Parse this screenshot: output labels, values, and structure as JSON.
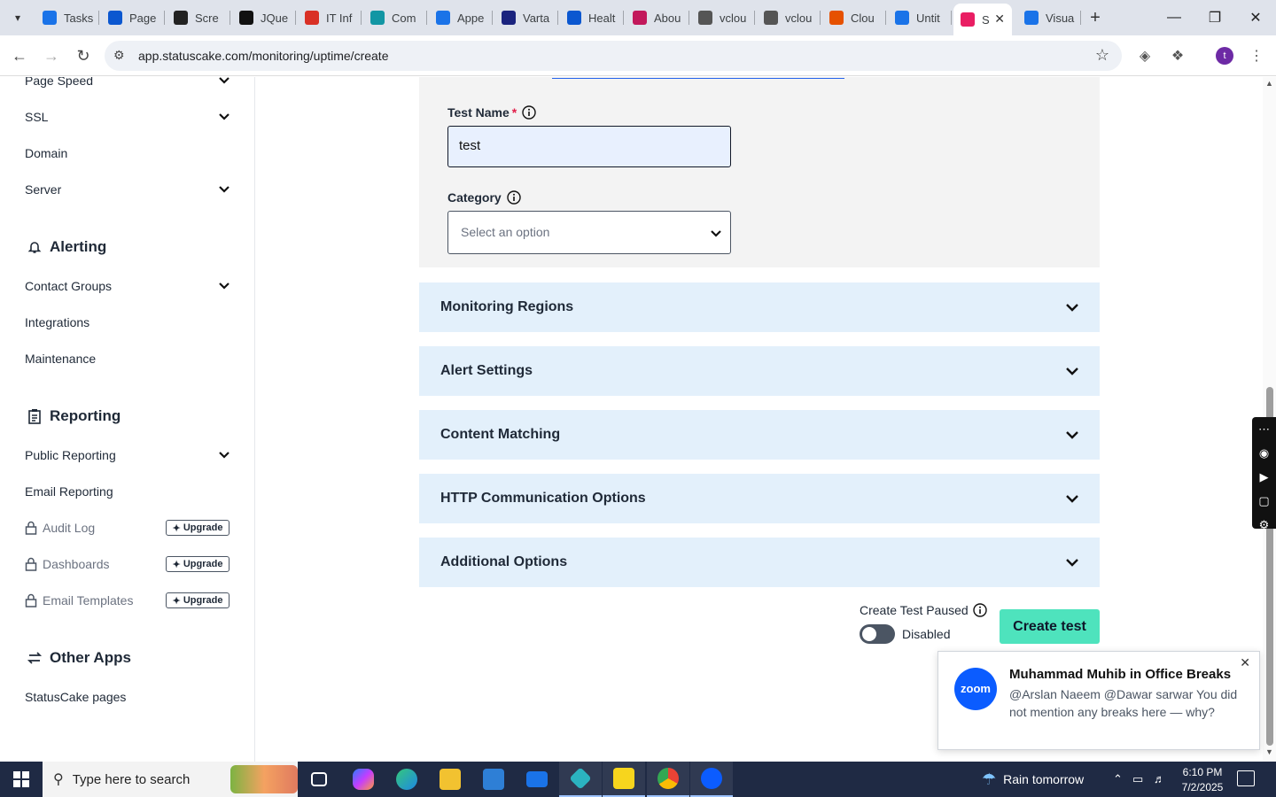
{
  "browser": {
    "tabs": [
      {
        "label": "Tasks",
        "color": "#1a73e8"
      },
      {
        "label": "Page",
        "color": "#0b57d0"
      },
      {
        "label": "Scre",
        "color": "#222222"
      },
      {
        "label": "JQue",
        "color": "#111111"
      },
      {
        "label": "IT Inf",
        "color": "#d93025"
      },
      {
        "label": "Com",
        "color": "#1296a4"
      },
      {
        "label": "Appe",
        "color": "#1a73e8"
      },
      {
        "label": "Varta",
        "color": "#1a237e"
      },
      {
        "label": "Healt",
        "color": "#0b57d0"
      },
      {
        "label": "Abou",
        "color": "#c2185b"
      },
      {
        "label": "vclou",
        "color": "#555555"
      },
      {
        "label": "vclou",
        "color": "#555555"
      },
      {
        "label": "Clou",
        "color": "#e65100"
      },
      {
        "label": "Untit",
        "color": "#1a73e8"
      },
      {
        "label": "S",
        "color": "#e91e63"
      },
      {
        "label": "Visua",
        "color": "#1a73e8"
      }
    ],
    "url": "app.statuscake.com/monitoring/uptime/create",
    "profile_initial": "t"
  },
  "sidebar": {
    "items_top": [
      {
        "label": "Page Speed",
        "chevron": true
      },
      {
        "label": "SSL",
        "chevron": true
      },
      {
        "label": "Domain",
        "chevron": false
      },
      {
        "label": "Server",
        "chevron": true
      }
    ],
    "alerting": {
      "heading": "Alerting",
      "items": [
        {
          "label": "Contact Groups",
          "chevron": true
        },
        {
          "label": "Integrations",
          "chevron": false
        },
        {
          "label": "Maintenance",
          "chevron": false
        }
      ]
    },
    "reporting": {
      "heading": "Reporting",
      "items": [
        {
          "label": "Public Reporting",
          "chevron": true
        },
        {
          "label": "Email Reporting",
          "chevron": false
        }
      ],
      "locked": [
        {
          "label": "Audit Log",
          "badge": "Upgrade"
        },
        {
          "label": "Dashboards",
          "badge": "Upgrade"
        },
        {
          "label": "Email Templates",
          "badge": "Upgrade"
        }
      ]
    },
    "other": {
      "heading": "Other Apps",
      "items": [
        {
          "label": "StatusCake pages"
        }
      ]
    }
  },
  "form": {
    "test_name_label": "Test Name",
    "required_mark": "*",
    "test_name_value": "test",
    "category_label": "Category",
    "category_placeholder": "Select an option"
  },
  "sections": [
    "Monitoring Regions",
    "Alert Settings",
    "Content Matching",
    "HTTP Communication Options",
    "Additional Options"
  ],
  "actions": {
    "paused_label": "Create Test Paused",
    "toggle_state": "Disabled",
    "create_button": "Create test"
  },
  "notification": {
    "app_logo": "zoom",
    "title": "Muhammad Muhib in Office Breaks",
    "body": "@Arslan Naeem @Dawar sarwar You did not mention any breaks here — why?"
  },
  "taskbar": {
    "search_placeholder": "Type here to search",
    "weather": "Rain tomorrow",
    "time": "6:10 PM",
    "date": "7/2/2025"
  },
  "colors": {
    "accent_button": "#4ee3bd",
    "accordion_bg": "#e3f0fb",
    "card_bg": "#f3f3f3"
  }
}
